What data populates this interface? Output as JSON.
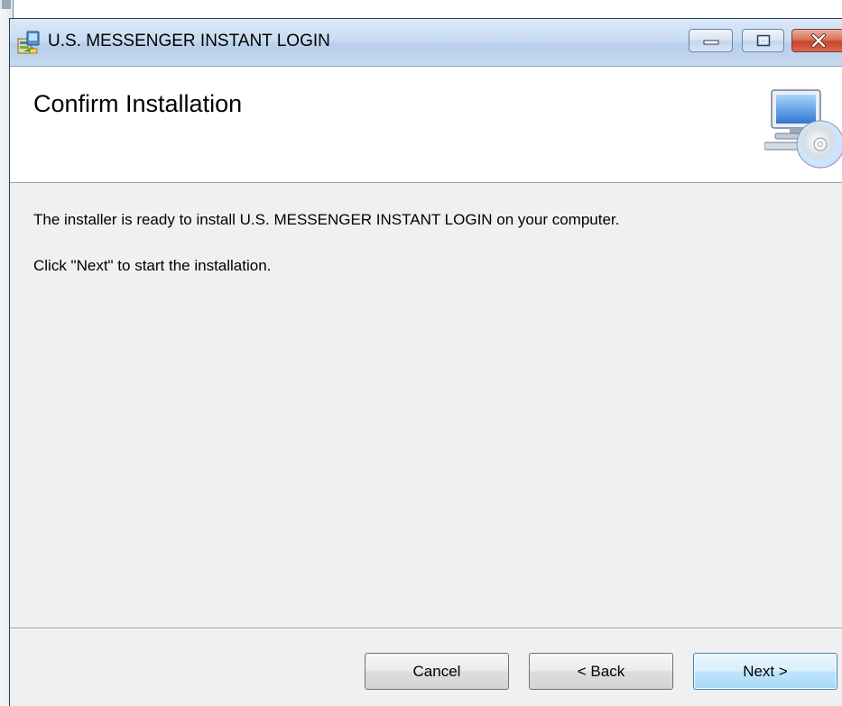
{
  "window": {
    "title": "U.S. MESSENGER INSTANT LOGIN",
    "icons": {
      "app": "installer-package-icon",
      "minimize": "minimize-icon",
      "maximize": "maximize-icon",
      "close": "close-icon"
    }
  },
  "banner": {
    "title": "Confirm Installation",
    "art_icon": "computer-cd-icon"
  },
  "body": {
    "line1": "The installer is ready to install U.S. MESSENGER INSTANT LOGIN on your computer.",
    "line2": "Click \"Next\" to start the installation."
  },
  "buttons": {
    "cancel": "Cancel",
    "back": "< Back",
    "next": "Next >"
  },
  "colors": {
    "titlebar": "#c9dcf1",
    "close_button": "#c9442a",
    "dialog_background": "#f0f0f0",
    "default_button_border": "#3c7fb1"
  }
}
